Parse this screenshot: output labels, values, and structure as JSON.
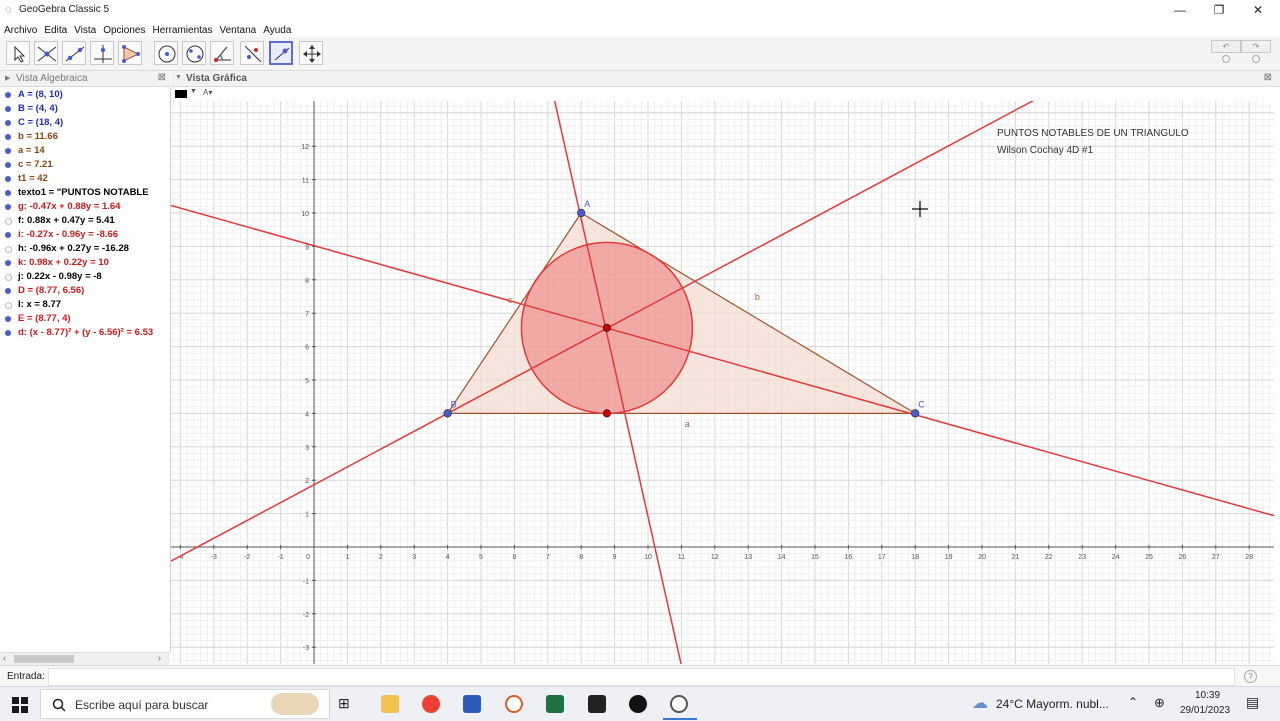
{
  "window": {
    "title": "GeoGebra Classic 5",
    "minimize": "—",
    "maximize": "❐",
    "close": "✕"
  },
  "menu": [
    "Archivo",
    "Edita",
    "Vista",
    "Opciones",
    "Herramientas",
    "Ventana",
    "Ayuda"
  ],
  "toolbar": {
    "tools": [
      "move-tool",
      "point-tool",
      "line-tool",
      "perpendicular-tool",
      "polygon-tool",
      "circle-tool",
      "ellipse-tool",
      "angle-tool",
      "reflect-tool",
      "slider-tool",
      "move-graphics-tool"
    ],
    "selected_index": 9
  },
  "algebra_view": {
    "title": "Vista Algebraica",
    "items": [
      {
        "text": "A = (8, 10)",
        "color": "#1f2fb4",
        "visible": true
      },
      {
        "text": "B = (4, 4)",
        "color": "#1f2fb4",
        "visible": true
      },
      {
        "text": "C = (18, 4)",
        "color": "#1f2fb4",
        "visible": true
      },
      {
        "text": "b = 11.66",
        "color": "#8b4513",
        "visible": true
      },
      {
        "text": "a = 14",
        "color": "#8b4513",
        "visible": true
      },
      {
        "text": "c = 7.21",
        "color": "#8b4513",
        "visible": true
      },
      {
        "text": "t1 = 42",
        "color": "#8b4513",
        "visible": true
      },
      {
        "text": "texto1 = \"PUNTOS NOTABLE",
        "color": "#000000",
        "visible": true
      },
      {
        "text": "g: -0.47x + 0.88y = 1.64",
        "color": "#cc1a1a",
        "visible": true
      },
      {
        "text": "f: 0.88x + 0.47y = 5.41",
        "color": "#000000",
        "visible": false
      },
      {
        "text": "i: -0.27x - 0.96y = -8.66",
        "color": "#cc1a1a",
        "visible": true
      },
      {
        "text": "h: -0.96x + 0.27y = -16.28",
        "color": "#000000",
        "visible": false
      },
      {
        "text": "k: 0.98x + 0.22y = 10",
        "color": "#cc1a1a",
        "visible": true
      },
      {
        "text": "j: 0.22x - 0.98y = -8",
        "color": "#000000",
        "visible": false
      },
      {
        "text": "D = (8.77, 6.56)",
        "color": "#cc1a1a",
        "visible": true
      },
      {
        "text": "l: x = 8.77",
        "color": "#000000",
        "visible": false
      },
      {
        "text": "E = (8.77, 4)",
        "color": "#cc1a1a",
        "visible": true
      },
      {
        "text": "d: (x - 8.77)² + (y - 6.56)² = 6.53",
        "color": "#cc1a1a",
        "visible": true
      }
    ]
  },
  "graphics_view": {
    "title": "Vista Gráfica",
    "text_line1": "PUNTOS NOTABLES DE UN TRIANGULO",
    "text_line2": "Wilson Cochay 4D #1",
    "x_range": [
      -4,
      28
    ],
    "y_range": [
      -3,
      12
    ],
    "points": [
      {
        "label": "A",
        "x": 8,
        "y": 10,
        "color": "#4a5bd0"
      },
      {
        "label": "B",
        "x": 4,
        "y": 4,
        "color": "#4a5bd0"
      },
      {
        "label": "C",
        "x": 18,
        "y": 4,
        "color": "#4a5bd0"
      },
      {
        "label": "",
        "x": 8.77,
        "y": 6.56,
        "color": "#cc0000"
      },
      {
        "label": "",
        "x": 8.77,
        "y": 4,
        "color": "#cc0000"
      }
    ],
    "segment_labels": [
      {
        "label": "a",
        "x": 11.1,
        "y": 3.6
      },
      {
        "label": "b",
        "x": 13.2,
        "y": 7.4
      },
      {
        "label": "c",
        "x": 5.8,
        "y": 7.3
      }
    ],
    "lines": [
      {
        "a": -0.47,
        "b": 0.88,
        "c": 1.64
      },
      {
        "a": -0.27,
        "b": -0.96,
        "c": -8.66
      },
      {
        "a": 0.98,
        "b": 0.22,
        "c": 10
      }
    ],
    "circle": {
      "cx": 8.77,
      "cy": 6.56,
      "r": 2.56
    },
    "line_color": "#e5383b",
    "triangle_fill": "#f3dcd0",
    "triangle_stroke": "#a0522d"
  },
  "input_bar": {
    "label": "Entrada:",
    "value": "",
    "help": "?"
  },
  "taskbar": {
    "search_placeholder": "Escribe aquí para buscar",
    "weather": "24°C  Mayorm. nubl...",
    "time": "10:39",
    "date": "29/01/2023"
  }
}
